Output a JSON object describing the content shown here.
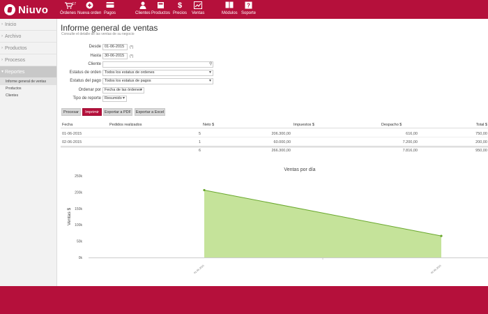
{
  "brand": {
    "name": "Niuvo"
  },
  "nav": [
    {
      "label": "Órdenes",
      "icon": "cart-icon",
      "badge": "17"
    },
    {
      "label": "Nueva orden",
      "icon": "new-order-icon"
    },
    {
      "label": "Pagos",
      "icon": "credit-card-icon"
    },
    {
      "label": "Clientes",
      "icon": "user-icon"
    },
    {
      "label": "Productos",
      "icon": "box-icon"
    },
    {
      "label": "Precios",
      "icon": "dollar-icon"
    },
    {
      "label": "Ventas",
      "icon": "chart-icon"
    },
    {
      "label": "Módulos",
      "icon": "modules-icon"
    },
    {
      "label": "Soporte",
      "icon": "help-icon"
    }
  ],
  "sidebar": {
    "items": [
      {
        "label": "Inicio"
      },
      {
        "label": "Archivo"
      },
      {
        "label": "Productos"
      },
      {
        "label": "Procesos"
      },
      {
        "label": "Reportes"
      }
    ],
    "subitems": [
      {
        "label": "Informe general de ventas"
      },
      {
        "label": "Productos"
      },
      {
        "label": "Clientes"
      }
    ]
  },
  "page": {
    "title": "Informe general de ventas",
    "subtitle": "Consulte el detalle de las ventas de su negocio"
  },
  "form": {
    "desde_label": "Desde",
    "desde_value": "01-06-2015",
    "hasta_label": "Hasta",
    "hasta_value": "30-06-2015",
    "required_mark": "(*)",
    "cliente_label": "Cliente",
    "cliente_value": "",
    "estatus_orden_label": "Estatus de orden",
    "estatus_orden_value": "Todos los estatus de ordenes",
    "estatus_pago_label": "Estatus del pago",
    "estatus_pago_value": "Todos los estatus de pagos",
    "ordenar_label": "Ordenar por",
    "ordenar_value": "Fecha de las órdenes",
    "tipo_label": "Tipo de reporte",
    "tipo_value": "Resumido"
  },
  "buttons": {
    "procesar": "Procesar",
    "imprimir": "Imprimir",
    "pdf": "Exportar a PDF",
    "excel": "Exportar a Excel"
  },
  "table": {
    "headers": [
      "Fecha",
      "Pedidos realizados",
      "Neto $",
      "Impuestos $",
      "Despacho $",
      "Total $"
    ],
    "rows": [
      [
        "01-06-2015",
        "5",
        "206.300,00",
        "",
        "616,00",
        "750,00"
      ],
      [
        "02-06-2015",
        "1",
        "60.000,00",
        "",
        "7.200,00",
        "200,00"
      ]
    ],
    "totals": [
      "",
      "6",
      "266.300,00",
      "",
      "7.816,00",
      "950,00"
    ]
  },
  "chart_data": {
    "type": "area",
    "title": "Ventas por día",
    "ylabel": "Ventas $",
    "xlabel": "",
    "x": [
      "01-06-2015",
      "02-06-2015"
    ],
    "series": [
      {
        "values": [
          206300,
          66000
        ]
      }
    ],
    "ylim": [
      0,
      250000
    ],
    "yticks": [
      0,
      50000,
      100000,
      150000,
      200000,
      250000
    ],
    "ytick_labels": [
      "0k",
      "50k",
      "100k",
      "150k",
      "200k",
      "250k"
    ],
    "color": "#c5e39a",
    "line_color": "#6aa82e",
    "grid": false,
    "legend": "none"
  }
}
